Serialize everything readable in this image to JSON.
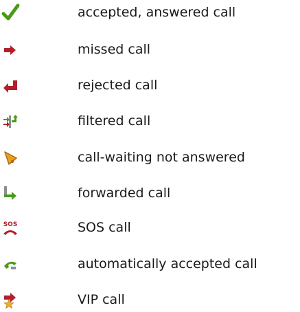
{
  "legend": {
    "items": [
      {
        "icon": "checkmark-icon",
        "label": "accepted, answered call"
      },
      {
        "icon": "right-arrow-icon",
        "label": "missed call"
      },
      {
        "icon": "return-arrow-icon",
        "label": "rejected call"
      },
      {
        "icon": "filter-icon",
        "label": "filtered call"
      },
      {
        "icon": "bell-icon",
        "label": "call-waiting not answered"
      },
      {
        "icon": "forward-arrow-icon",
        "label": "forwarded call"
      },
      {
        "icon": "sos-phone-icon",
        "label": "SOS call"
      },
      {
        "icon": "auto-answer-phone-icon",
        "label": "automatically accepted call"
      },
      {
        "icon": "vip-arrow-icon",
        "label": "VIP call"
      }
    ]
  },
  "colors": {
    "green": "#4a9a16",
    "red": "#b0202a",
    "orange": "#e8a020",
    "gray": "#8a8f96",
    "text": "#1a1a1a"
  }
}
